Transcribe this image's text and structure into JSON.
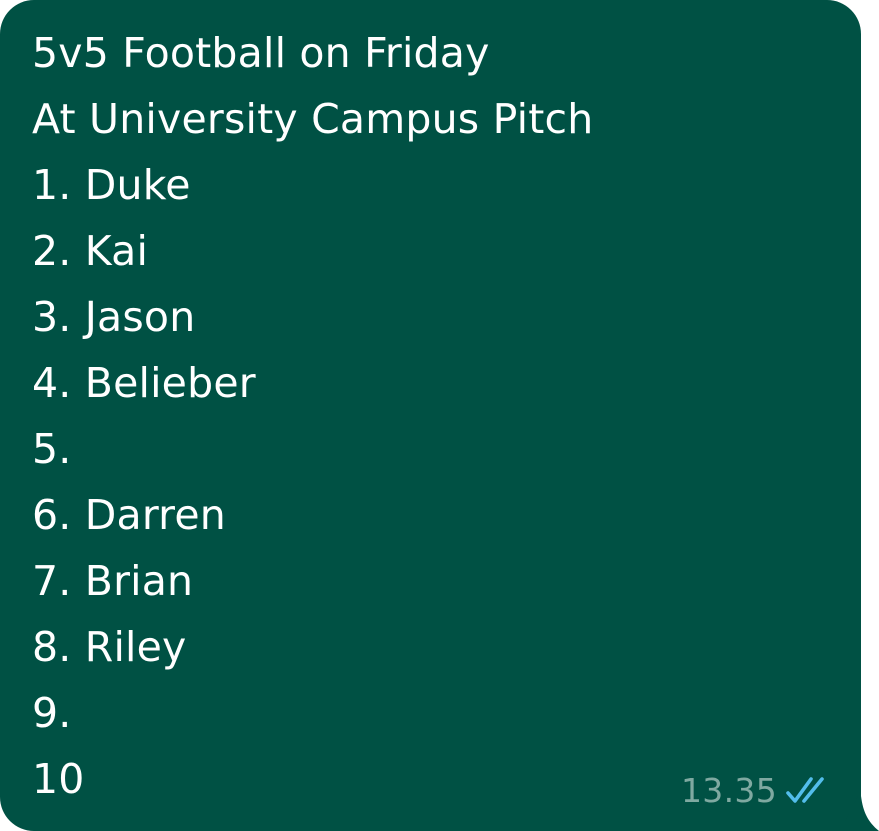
{
  "message": {
    "lines": [
      "5v5 Football on Friday",
      "At University Campus Pitch",
      "1. Duke",
      "2. Kai",
      "3. Jason",
      "4. Belieber",
      "5.",
      "6. Darren",
      "7. Brian",
      "8. Riley",
      "9.",
      "10"
    ],
    "timestamp": "13.35",
    "status_icon": "double-check-read-icon"
  },
  "colors": {
    "bubble": "#005144",
    "text": "#ffffff",
    "timestamp": "#7fa9a1",
    "read_ticks": "#53bdeb"
  }
}
